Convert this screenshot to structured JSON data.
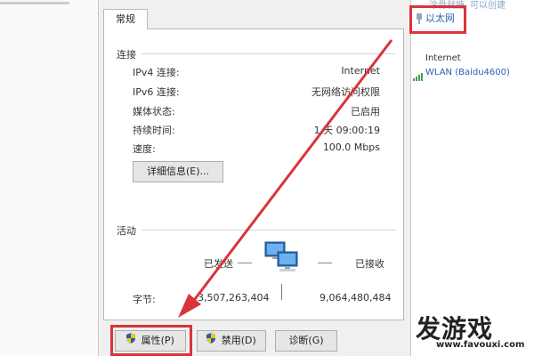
{
  "dialog": {
    "tab_label": "常规",
    "connection": {
      "title": "连接",
      "rows": [
        {
          "label": "IPv4 连接:",
          "value": "Internet"
        },
        {
          "label": "IPv6 连接:",
          "value": "无网络访问权限"
        },
        {
          "label": "媒体状态:",
          "value": "已启用"
        },
        {
          "label": "持续时间:",
          "value": "1 天 09:00:19"
        },
        {
          "label": "速度:",
          "value": "100.0 Mbps"
        }
      ],
      "details_button": "详细信息(E)..."
    },
    "activity": {
      "title": "活动",
      "sent_label": "已发送",
      "received_label": "已接收",
      "bytes_label": "字节:",
      "bytes_sent": "3,507,263,404",
      "bytes_received": "9,064,480,484"
    },
    "buttons": {
      "properties": "属性(P)",
      "disable": "禁用(D)",
      "diagnose": "诊断(G)"
    }
  },
  "network_panel": {
    "top_left": "涂骨就搪",
    "top_right": "可以创建",
    "ethernet": "以太网",
    "internet_label": "Internet",
    "wlan": "WLAN (Baidu4600)"
  },
  "watermark": {
    "name": "发游戏",
    "url": "www.favouxi.com"
  },
  "colors": {
    "highlight": "#d9343a",
    "link": "#2a61b0"
  },
  "icons": [
    "network-computers-icon",
    "shield-icon",
    "ethernet-icon",
    "wifi-signal-icon"
  ]
}
